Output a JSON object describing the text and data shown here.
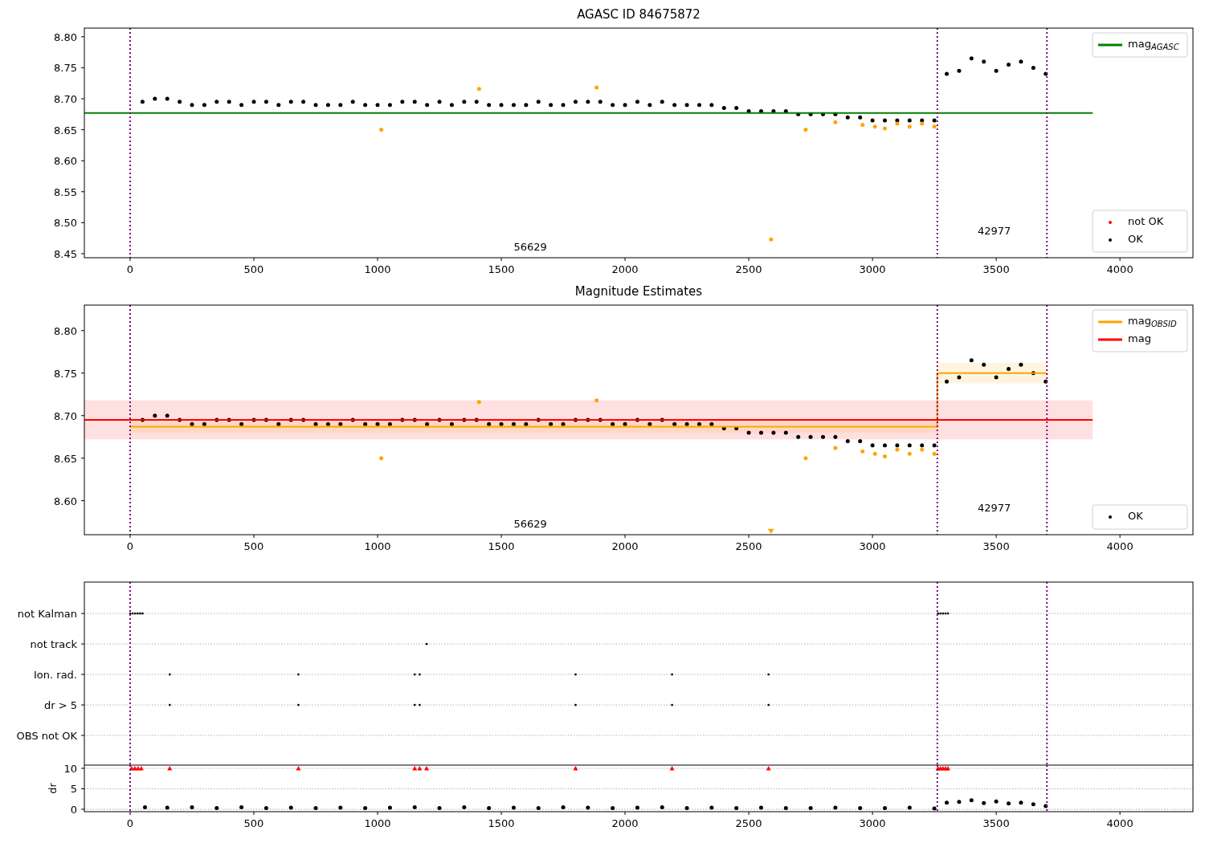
{
  "panels": [
    {
      "chart_data": {
        "type": "scatter",
        "title": "AGASC ID 84675872",
        "xlim": [
          -185,
          4295
        ],
        "ylim": [
          8.4435,
          8.814
        ],
        "legend": true,
        "xticks": [
          0,
          500,
          1000,
          1500,
          2000,
          2500,
          3000,
          3500,
          4000
        ],
        "yticks": [
          {
            "value": 8.45,
            "label": "8.45"
          },
          {
            "value": 8.5,
            "label": "8.50"
          },
          {
            "value": 8.55,
            "label": "8.55"
          },
          {
            "value": 8.6,
            "label": "8.60"
          },
          {
            "value": 8.65,
            "label": "8.65"
          },
          {
            "value": 8.7,
            "label": "8.70"
          },
          {
            "value": 8.75,
            "label": "8.75"
          },
          {
            "value": 8.8,
            "label": "8.80"
          }
        ],
        "series": [
          {
            "name": "not OK",
            "color": "#ff0000"
          },
          {
            "name": "OK",
            "color": "#000000",
            "x": [
              50,
              100,
              150,
              200,
              250,
              300,
              350,
              400,
              450,
              500,
              550,
              600,
              650,
              700,
              750,
              800,
              850,
              900,
              950,
              1000,
              1050,
              1100,
              1150,
              1200,
              1250,
              1300,
              1350,
              1400,
              1450,
              1500,
              1550,
              1600,
              1650,
              1700,
              1750,
              1800,
              1850,
              1900,
              1950,
              2000,
              2050,
              2100,
              2150,
              2200,
              2250,
              2300,
              2350,
              2400,
              2450,
              2500,
              2550,
              2600,
              2650,
              2700,
              2750,
              2800,
              2850,
              2900,
              2950,
              3000,
              3050,
              3100,
              3150,
              3200,
              3250,
              3300,
              3350,
              3400,
              3450,
              3500,
              3550,
              3600,
              3650,
              3700
            ],
            "values": [
              8.695,
              8.7,
              8.7,
              8.695,
              8.69,
              8.69,
              8.695,
              8.695,
              8.69,
              8.695,
              8.695,
              8.69,
              8.695,
              8.695,
              8.69,
              8.69,
              8.69,
              8.695,
              8.69,
              8.69,
              8.69,
              8.695,
              8.695,
              8.69,
              8.695,
              8.69,
              8.695,
              8.695,
              8.69,
              8.69,
              8.69,
              8.69,
              8.695,
              8.69,
              8.69,
              8.695,
              8.695,
              8.695,
              8.69,
              8.69,
              8.695,
              8.69,
              8.695,
              8.69,
              8.69,
              8.69,
              8.69,
              8.685,
              8.685,
              8.68,
              8.68,
              8.68,
              8.68,
              8.675,
              8.675,
              8.675,
              8.675,
              8.67,
              8.67,
              8.665,
              8.665,
              8.665,
              8.665,
              8.665,
              8.665,
              8.74,
              8.745,
              8.765,
              8.76,
              8.745,
              8.755,
              8.76,
              8.75,
              8.74
            ]
          },
          {
            "color": "#ffa500",
            "x": [
              1015,
              1410,
              1885,
              2590,
              2730,
              2850,
              2960,
              3010,
              3050,
              3100,
              3150,
              3200,
              3250
            ],
            "values": [
              8.65,
              8.716,
              8.718,
              8.473,
              8.65,
              8.662,
              8.658,
              8.655,
              8.652,
              8.66,
              8.655,
              8.66,
              8.655
            ]
          },
          {
            "name": "mag$_{AGASC}$",
            "type": "line",
            "color": "#008000",
            "marker": "none",
            "x": [
              -185,
              3890
            ],
            "values": [
              8.677,
              8.677
            ]
          }
        ],
        "ref_lines": [
          {
            "axis": "x",
            "value": 0,
            "color": "#800080"
          },
          {
            "axis": "x",
            "value": 3262,
            "color": "#800080"
          },
          {
            "axis": "x",
            "value": 3705,
            "color": "#800080"
          }
        ],
        "annotations": [
          "56629",
          "42977"
        ]
      }
    },
    {
      "chart_data": {
        "type": "scatter",
        "title": "Magnitude Estimates",
        "xlim": [
          -185,
          4295
        ],
        "ylim": [
          8.56,
          8.83
        ],
        "legend": true,
        "xticks": [
          0,
          500,
          1000,
          1500,
          2000,
          2500,
          3000,
          3500,
          4000
        ],
        "yticks": [
          {
            "value": 8.6,
            "label": "8.60"
          },
          {
            "value": 8.65,
            "label": "8.65"
          },
          {
            "value": 8.7,
            "label": "8.70"
          },
          {
            "value": 8.75,
            "label": "8.75"
          },
          {
            "value": 8.8,
            "label": "8.80"
          }
        ],
        "series": [
          {
            "name": "OK",
            "color": "#000000",
            "x": [
              50,
              100,
              150,
              200,
              250,
              300,
              350,
              400,
              450,
              500,
              550,
              600,
              650,
              700,
              750,
              800,
              850,
              900,
              950,
              1000,
              1050,
              1100,
              1150,
              1200,
              1250,
              1300,
              1350,
              1400,
              1450,
              1500,
              1550,
              1600,
              1650,
              1700,
              1750,
              1800,
              1850,
              1900,
              1950,
              2000,
              2050,
              2100,
              2150,
              2200,
              2250,
              2300,
              2350,
              2400,
              2450,
              2500,
              2550,
              2600,
              2650,
              2700,
              2750,
              2800,
              2850,
              2900,
              2950,
              3000,
              3050,
              3100,
              3150,
              3200,
              3250,
              3300,
              3350,
              3400,
              3450,
              3500,
              3550,
              3600,
              3650,
              3700
            ],
            "values": [
              8.695,
              8.7,
              8.7,
              8.695,
              8.69,
              8.69,
              8.695,
              8.695,
              8.69,
              8.695,
              8.695,
              8.69,
              8.695,
              8.695,
              8.69,
              8.69,
              8.69,
              8.695,
              8.69,
              8.69,
              8.69,
              8.695,
              8.695,
              8.69,
              8.695,
              8.69,
              8.695,
              8.695,
              8.69,
              8.69,
              8.69,
              8.69,
              8.695,
              8.69,
              8.69,
              8.695,
              8.695,
              8.695,
              8.69,
              8.69,
              8.695,
              8.69,
              8.695,
              8.69,
              8.69,
              8.69,
              8.69,
              8.685,
              8.685,
              8.68,
              8.68,
              8.68,
              8.68,
              8.675,
              8.675,
              8.675,
              8.675,
              8.67,
              8.67,
              8.665,
              8.665,
              8.665,
              8.665,
              8.665,
              8.665,
              8.74,
              8.745,
              8.765,
              8.76,
              8.745,
              8.755,
              8.76,
              8.75,
              8.74
            ]
          },
          {
            "color": "#ffa500",
            "x": [
              1015,
              1410,
              1885,
              2730,
              2850,
              2960,
              3010,
              3050,
              3100,
              3150,
              3200,
              3250
            ],
            "values": [
              8.65,
              8.716,
              8.718,
              8.65,
              8.662,
              8.658,
              8.655,
              8.652,
              8.66,
              8.655,
              8.66,
              8.655
            ]
          },
          {
            "color": "#ffa500",
            "marker": "triangle",
            "x": [
              2590
            ],
            "values": [
              8.563
            ]
          },
          {
            "name": "mag$_{OBSID}$",
            "type": "line",
            "color": "#ffa500",
            "marker": "none",
            "x": [
              0,
              3262,
              3262,
              3705
            ],
            "values": [
              8.687,
              8.687,
              8.75,
              8.75
            ]
          },
          {
            "name": "mag",
            "type": "line",
            "color": "#ff0000",
            "marker": "none",
            "x": [
              -185,
              3890
            ],
            "values": [
              8.695,
              8.695
            ]
          }
        ],
        "bands": [
          {
            "axis": "y",
            "from": 8.672,
            "to": 8.718,
            "color": "#ff0000"
          },
          {
            "axis": "y",
            "from": 8.68,
            "to": 8.694,
            "color": "#ffa500"
          },
          {
            "axis": "y",
            "from": 8.738,
            "to": 8.762,
            "color": "#ffa500"
          }
        ],
        "ref_lines": [
          {
            "axis": "x",
            "value": 0,
            "color": "#800080"
          },
          {
            "axis": "x",
            "value": 3262,
            "color": "#800080"
          },
          {
            "axis": "x",
            "value": 3705,
            "color": "#800080"
          }
        ],
        "annotations": [
          "56629",
          "42977"
        ]
      }
    },
    {
      "chart_data": {
        "type": "scatter",
        "orientation": "horizontal",
        "xlim": [
          -185,
          4295
        ],
        "grid": true,
        "categories": [
          "not Kalman",
          "not track",
          "Ion. rad.",
          "dr > 5",
          "OBS not OK"
        ],
        "series": [
          {
            "color": "#000000",
            "marker": "square",
            "values": [
              0,
              1198,
              160,
              160,
              null
            ]
          },
          {
            "color": "#000000",
            "marker": "square",
            "values": [
              10,
              null,
              680,
              680,
              null
            ]
          },
          {
            "color": "#000000",
            "marker": "square",
            "values": [
              20,
              null,
              1150,
              1150,
              null
            ]
          },
          {
            "color": "#000000",
            "marker": "square",
            "values": [
              30,
              null,
              1170,
              1170,
              null
            ]
          },
          {
            "color": "#000000",
            "marker": "square",
            "values": [
              40,
              null,
              1800,
              1800,
              null
            ]
          },
          {
            "color": "#000000",
            "marker": "square",
            "values": [
              50,
              null,
              2190,
              2190,
              null
            ]
          },
          {
            "color": "#000000",
            "marker": "square",
            "values": [
              3265,
              null,
              2580,
              2580,
              null
            ]
          },
          {
            "color": "#000000",
            "marker": "square",
            "values": [
              3275,
              null,
              null,
              null,
              null
            ]
          },
          {
            "color": "#000000",
            "marker": "square",
            "values": [
              3285,
              null,
              null,
              null,
              null
            ]
          },
          {
            "color": "#000000",
            "marker": "square",
            "values": [
              3295,
              null,
              null,
              null,
              null
            ]
          },
          {
            "color": "#000000",
            "marker": "square",
            "values": [
              3305,
              null,
              null,
              null,
              null
            ]
          }
        ],
        "ref_lines": [
          {
            "axis": "x",
            "value": 0,
            "color": "#800080"
          },
          {
            "axis": "x",
            "value": 3262,
            "color": "#800080"
          },
          {
            "axis": "x",
            "value": 3705,
            "color": "#800080"
          }
        ]
      }
    },
    {
      "chart_data": {
        "type": "scatter",
        "ylabel": "dr",
        "xlim": [
          -185,
          4295
        ],
        "ylim": [
          -0.59,
          10.78
        ],
        "grid": true,
        "xticks": [
          0,
          500,
          1000,
          1500,
          2000,
          2500,
          3000,
          3500,
          4000
        ],
        "yticks": [
          0,
          5,
          10
        ],
        "series": [
          {
            "color": "#ff0000",
            "marker": "triangle",
            "x": [
              6,
              19,
              32,
              45,
              160,
              680,
              1150,
              1170,
              1198,
              1800,
              2190,
              2580,
              3265,
              3275,
              3285,
              3295,
              3305
            ],
            "values": [
              10,
              10,
              10,
              10,
              10,
              10,
              10,
              10,
              10,
              10,
              10,
              10,
              10,
              10,
              10,
              10,
              10
            ]
          },
          {
            "color": "#000000",
            "x": [
              60,
              150,
              250,
              350,
              450,
              550,
              650,
              750,
              850,
              950,
              1050,
              1150,
              1250,
              1350,
              1450,
              1550,
              1650,
              1750,
              1850,
              1950,
              2050,
              2150,
              2250,
              2350,
              2450,
              2550,
              2650,
              2750,
              2850,
              2950,
              3050,
              3150,
              3250,
              3300,
              3350,
              3400,
              3450,
              3500,
              3550,
              3600,
              3650,
              3700
            ],
            "values": [
              0.5,
              0.4,
              0.5,
              0.3,
              0.5,
              0.3,
              0.4,
              0.3,
              0.4,
              0.3,
              0.4,
              0.5,
              0.3,
              0.5,
              0.3,
              0.4,
              0.3,
              0.5,
              0.4,
              0.3,
              0.4,
              0.5,
              0.3,
              0.4,
              0.3,
              0.4,
              0.3,
              0.3,
              0.4,
              0.3,
              0.3,
              0.4,
              0.2,
              1.6,
              1.8,
              2.2,
              1.5,
              1.9,
              1.4,
              1.6,
              1.2,
              0.8
            ]
          }
        ],
        "ref_lines": [
          {
            "axis": "x",
            "value": 0,
            "color": "#800080"
          },
          {
            "axis": "x",
            "value": 3262,
            "color": "#800080"
          },
          {
            "axis": "x",
            "value": 3705,
            "color": "#800080"
          }
        ]
      }
    }
  ]
}
